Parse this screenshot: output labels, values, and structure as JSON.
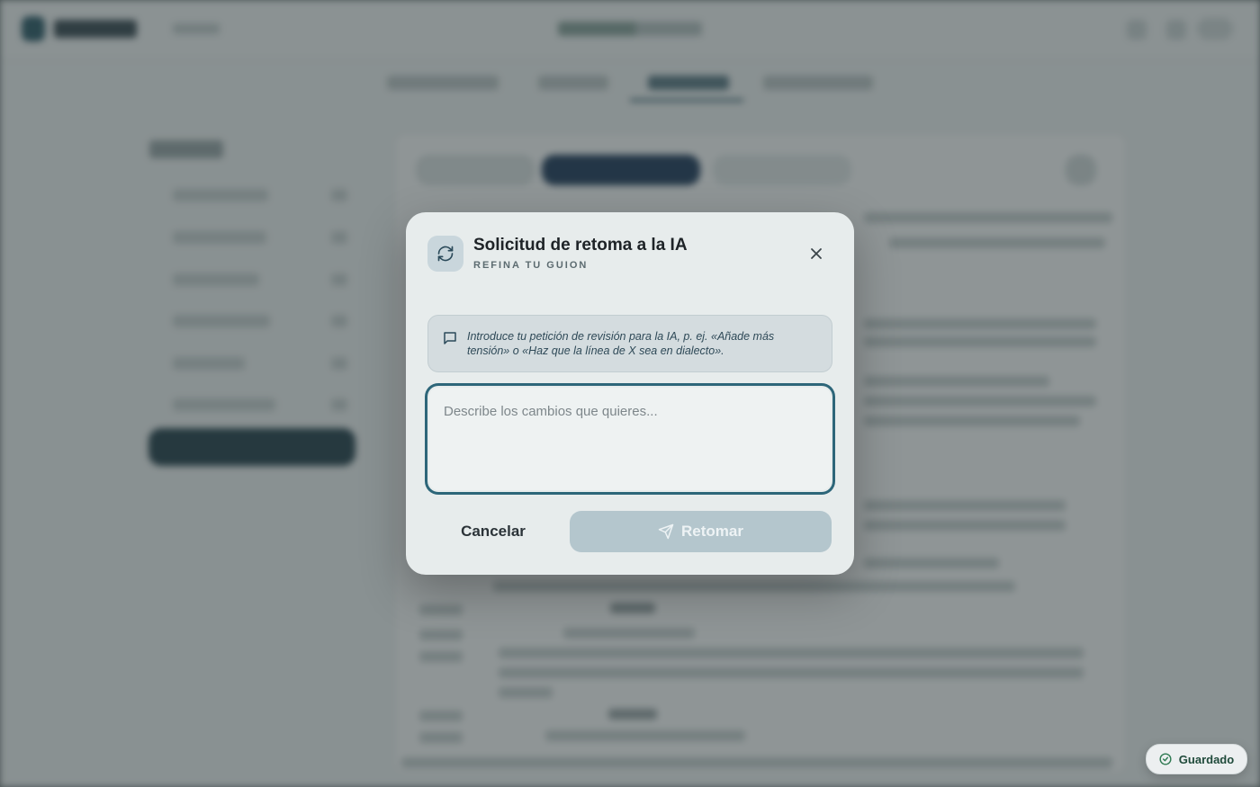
{
  "modal": {
    "title": "Solicitud de retoma a la IA",
    "subtitle": "REFINA TU GUION",
    "icon": "refresh-icon",
    "close_icon": "close-icon",
    "hint": {
      "icon": "message-icon",
      "text": "Introduce tu petición de revisión para la IA, p. ej. «Añade más tensión» o «Haz que la línea de X sea en dialecto»."
    },
    "input": {
      "placeholder": "Describe los cambios que quieres...",
      "value": ""
    },
    "cancel_label": "Cancelar",
    "submit_label": "Retomar",
    "submit_icon": "send-icon"
  },
  "toast": {
    "label": "Guardado",
    "icon": "check-circle-icon"
  },
  "colors": {
    "accent": "#2d6679",
    "overlay": "#283436",
    "submit_disabled": "#b4c6cd",
    "success": "#2f7a52"
  }
}
